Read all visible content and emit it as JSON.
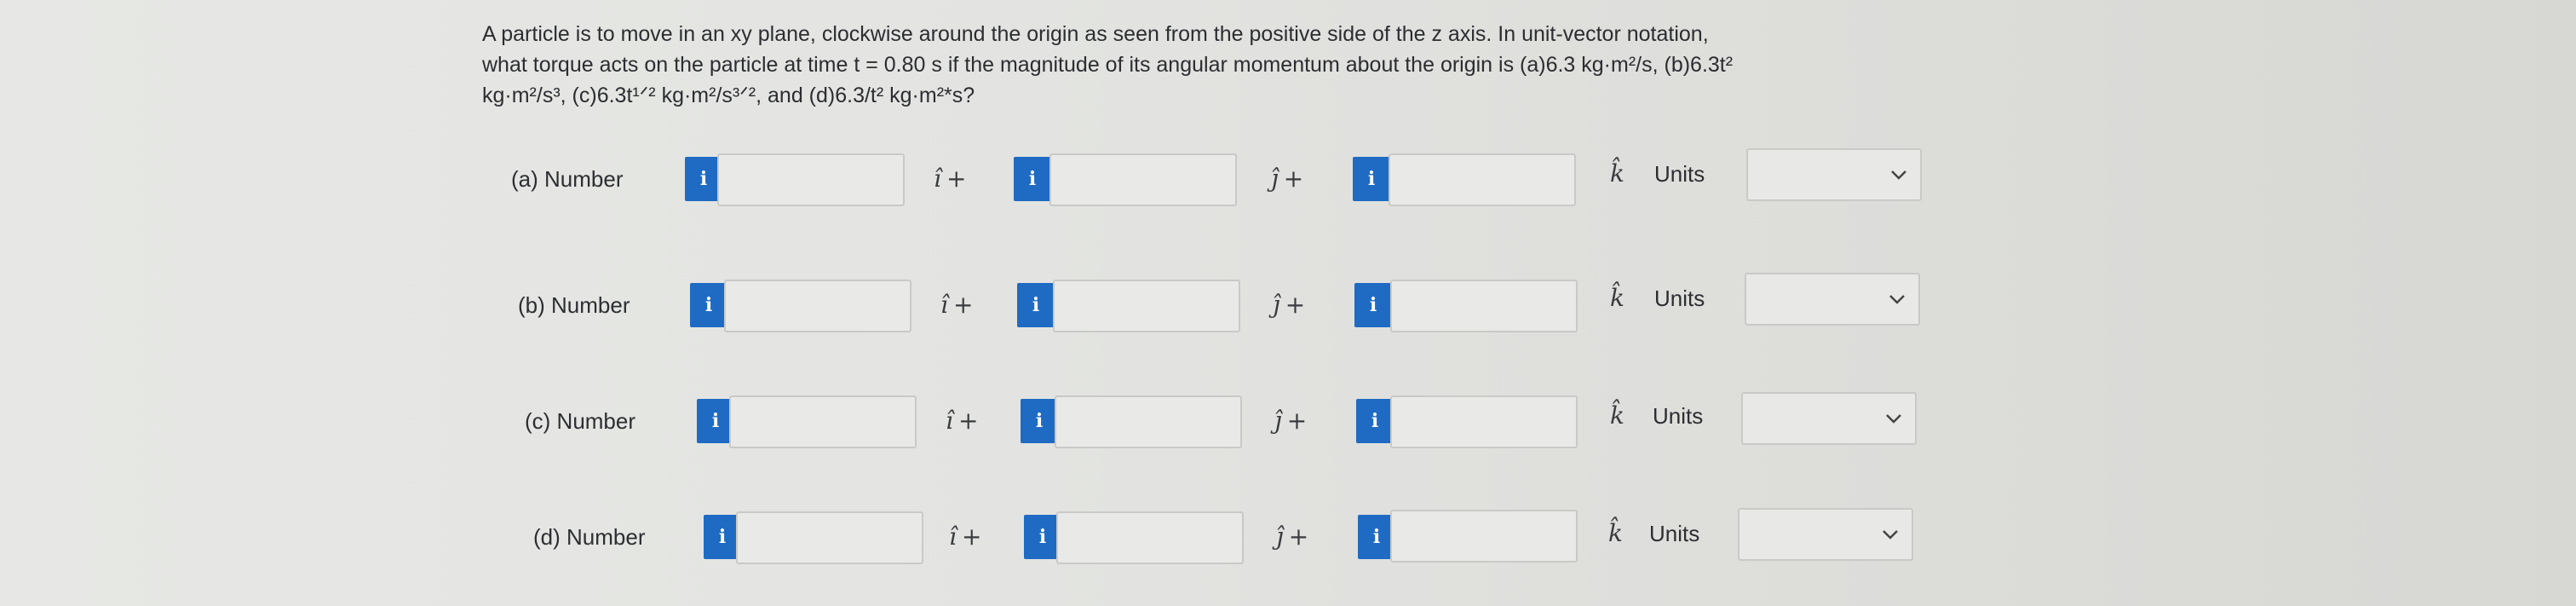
{
  "question": {
    "line1": "A particle is to move in an xy plane, clockwise around the origin as seen from the positive side of the z axis. In unit-vector notation,",
    "line2": "what torque acts on the particle at time t = 0.80 s if the magnitude of its angular momentum about the origin is (a)6.3 kg·m²/s, (b)6.3t²",
    "line3": "kg·m²/s³, (c)6.3t¹ᐟ² kg·m²/s³ᐟ², and (d)6.3/t² kg·m²*s?"
  },
  "parts": [
    {
      "label": "(a)  Number",
      "i_comp": "",
      "j_comp": "",
      "k_comp": "",
      "units": ""
    },
    {
      "label": "(b)  Number",
      "i_comp": "",
      "j_comp": "",
      "k_comp": "",
      "units": ""
    },
    {
      "label": "(c)  Number",
      "i_comp": "",
      "j_comp": "",
      "k_comp": "",
      "units": ""
    },
    {
      "label": "(d)  Number",
      "i_comp": "",
      "j_comp": "",
      "k_comp": "",
      "units": ""
    }
  ],
  "symbols": {
    "info": "i",
    "i_hat": "î",
    "j_hat": "ĵ",
    "k_hat": "k̂",
    "plus": "+",
    "units_label": "Units"
  },
  "colors": {
    "info_button": "#1f6bc4",
    "background": "#e3e4e1"
  }
}
